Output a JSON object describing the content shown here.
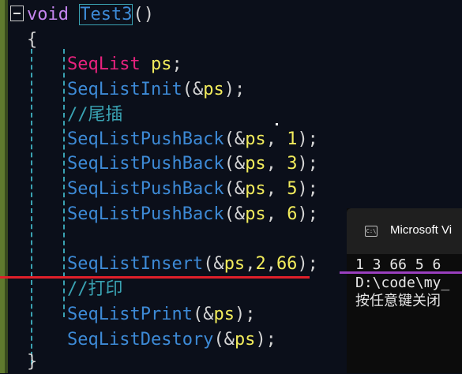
{
  "editor": {
    "lines": [
      {
        "id": "l0",
        "tokens": [
          {
            "c": "kw",
            "t": "void"
          },
          {
            "c": "punc",
            "t": " "
          },
          {
            "c": "fn",
            "t": "Test3",
            "boxed": true
          },
          {
            "c": "punc",
            "t": "()"
          }
        ]
      },
      {
        "id": "l1",
        "tokens": [
          {
            "c": "punc",
            "t": "{"
          }
        ]
      },
      {
        "id": "l2",
        "tokens": []
      },
      {
        "id": "l3",
        "tokens": [
          {
            "c": "ty",
            "t": "SeqList"
          },
          {
            "c": "punc",
            "t": " "
          },
          {
            "c": "var",
            "t": "ps"
          },
          {
            "c": "punc",
            "t": ";"
          }
        ]
      },
      {
        "id": "l4",
        "tokens": [
          {
            "c": "fn",
            "t": "SeqListInit"
          },
          {
            "c": "punc",
            "t": "(&"
          },
          {
            "c": "var",
            "t": "ps"
          },
          {
            "c": "punc",
            "t": ");"
          }
        ]
      },
      {
        "id": "l5",
        "tokens": [
          {
            "c": "cmt",
            "t": "//尾插"
          }
        ]
      },
      {
        "id": "l6",
        "tokens": [
          {
            "c": "fn",
            "t": "SeqListPushBack"
          },
          {
            "c": "punc",
            "t": "(&"
          },
          {
            "c": "var",
            "t": "ps"
          },
          {
            "c": "punc",
            "t": ", "
          },
          {
            "c": "num",
            "t": "1"
          },
          {
            "c": "punc",
            "t": ");"
          }
        ]
      },
      {
        "id": "l7",
        "tokens": [
          {
            "c": "fn",
            "t": "SeqListPushBack"
          },
          {
            "c": "punc",
            "t": "(&"
          },
          {
            "c": "var",
            "t": "ps"
          },
          {
            "c": "punc",
            "t": ", "
          },
          {
            "c": "num",
            "t": "3"
          },
          {
            "c": "punc",
            "t": ");"
          }
        ]
      },
      {
        "id": "l8",
        "tokens": [
          {
            "c": "fn",
            "t": "SeqListPushBack"
          },
          {
            "c": "punc",
            "t": "(&"
          },
          {
            "c": "var",
            "t": "ps"
          },
          {
            "c": "punc",
            "t": ", "
          },
          {
            "c": "num",
            "t": "5"
          },
          {
            "c": "punc",
            "t": ");"
          }
        ]
      },
      {
        "id": "l9",
        "tokens": [
          {
            "c": "fn",
            "t": "SeqListPushBack"
          },
          {
            "c": "punc",
            "t": "(&"
          },
          {
            "c": "var",
            "t": "ps"
          },
          {
            "c": "punc",
            "t": ", "
          },
          {
            "c": "num",
            "t": "6"
          },
          {
            "c": "punc",
            "t": ");"
          }
        ]
      },
      {
        "id": "l10",
        "tokens": []
      },
      {
        "id": "l11",
        "tokens": [
          {
            "c": "fn",
            "t": "SeqListInsert"
          },
          {
            "c": "punc",
            "t": "(&"
          },
          {
            "c": "var",
            "t": "ps"
          },
          {
            "c": "punc",
            "t": ","
          },
          {
            "c": "num",
            "t": "2"
          },
          {
            "c": "punc",
            "t": ","
          },
          {
            "c": "num",
            "t": "66"
          },
          {
            "c": "punc",
            "t": ");"
          }
        ]
      },
      {
        "id": "l12",
        "tokens": [
          {
            "c": "cmt",
            "t": "//打印"
          }
        ]
      },
      {
        "id": "l13",
        "tokens": [
          {
            "c": "fn",
            "t": "SeqListPrint"
          },
          {
            "c": "punc",
            "t": "(&"
          },
          {
            "c": "var",
            "t": "ps"
          },
          {
            "c": "punc",
            "t": ");"
          }
        ]
      },
      {
        "id": "l14",
        "tokens": [
          {
            "c": "fn",
            "t": "SeqListDestory"
          },
          {
            "c": "punc",
            "t": "(&"
          },
          {
            "c": "var",
            "t": "ps"
          },
          {
            "c": "punc",
            "t": ");"
          }
        ]
      },
      {
        "id": "l15",
        "tokens": [
          {
            "c": "punc",
            "t": "}"
          }
        ]
      }
    ]
  },
  "console": {
    "title": "Microsoft Vi",
    "icon": "terminal-icon",
    "icon_text": "C:\\",
    "output": [
      "1 3 66 5 6",
      "D:\\code\\my_",
      "按任意键关闭"
    ]
  },
  "colors": {
    "keyword": "#c586f0",
    "function": "#3d8ad6",
    "type": "#e8227e",
    "variable": "#f2ec5c",
    "comment": "#3aa3b3",
    "underline_red": "#e0202a",
    "underline_purple": "#9a3fbf"
  }
}
